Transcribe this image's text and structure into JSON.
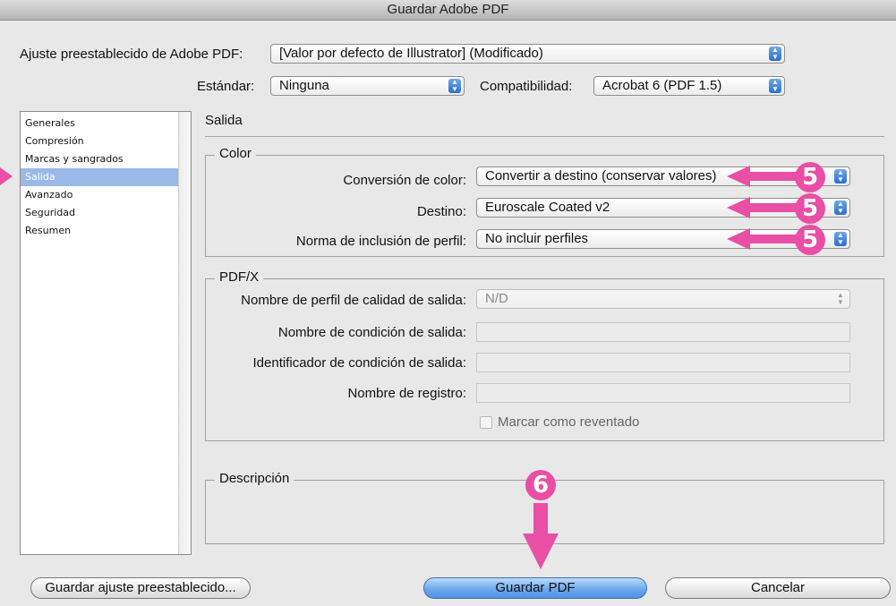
{
  "window": {
    "title": "Guardar Adobe PDF"
  },
  "preset": {
    "label": "Ajuste preestablecido de Adobe PDF:",
    "value": "[Valor por defecto de Illustrator] (Modificado)"
  },
  "standard": {
    "label": "Estándar:",
    "value": "Ninguna"
  },
  "compat": {
    "label": "Compatibilidad:",
    "value": "Acrobat 6 (PDF 1.5)"
  },
  "sidebar": {
    "items": [
      {
        "label": "Generales"
      },
      {
        "label": "Compresión"
      },
      {
        "label": "Marcas y sangrados"
      },
      {
        "label": "Salida",
        "selected": true
      },
      {
        "label": "Avanzado"
      },
      {
        "label": "Seguridad"
      },
      {
        "label": "Resumen"
      }
    ]
  },
  "section": {
    "title": "Salida"
  },
  "color_group": {
    "legend": "Color",
    "conversion": {
      "label": "Conversión de color:",
      "value": "Convertir a destino (conservar valores)"
    },
    "destination": {
      "label": "Destino:",
      "value": "Euroscale Coated v2"
    },
    "profile": {
      "label": "Norma de inclusión de perfil:",
      "value": "No incluir perfiles"
    }
  },
  "pdfx_group": {
    "legend": "PDF/X",
    "output_profile": {
      "label": "Nombre de perfil de calidad de salida:",
      "value": "N/D"
    },
    "condition_name": {
      "label": "Nombre de condición de salida:",
      "value": ""
    },
    "condition_id": {
      "label": "Identificador de condición de salida:",
      "value": ""
    },
    "registry": {
      "label": "Nombre de registro:",
      "value": ""
    },
    "trapped": {
      "label": "Marcar como reventado",
      "checked": false
    }
  },
  "description_group": {
    "legend": "Descripción"
  },
  "annotations": {
    "step5": "5",
    "step6": "6",
    "color": "#e84fa5"
  },
  "buttons": {
    "save_preset": "Guardar ajuste preestablecido...",
    "save_pdf": "Guardar PDF",
    "cancel": "Cancelar"
  }
}
